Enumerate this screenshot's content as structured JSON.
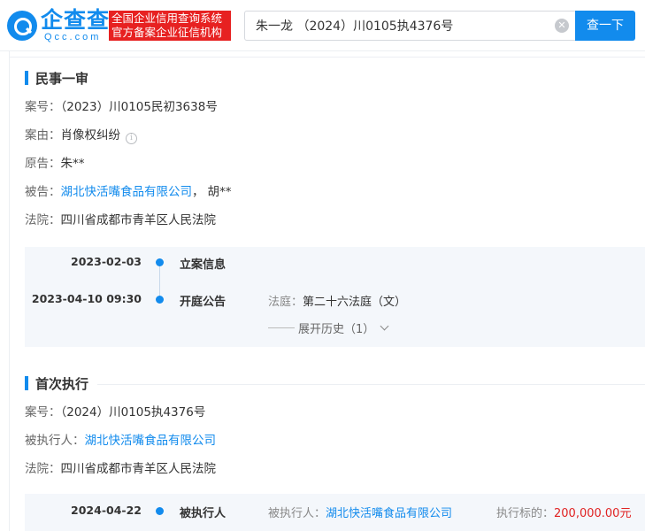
{
  "header": {
    "logo_cn": "企查查",
    "logo_en": "Qcc.com",
    "slogan_line1": "全国企业信用查询系统",
    "slogan_line2": "官方备案企业征信机构",
    "search_value": "朱一龙 （2024）川0105执4376号",
    "search_button": "查一下"
  },
  "first_trial": {
    "title": "民事一审",
    "case_no_label": "案号：",
    "case_no": "（2023）川0105民初3638号",
    "cause_label": "案由：",
    "cause": "肖像权纠纷",
    "plaintiff_label": "原告：",
    "plaintiff": "朱**",
    "defendant_label": "被告：",
    "defendant_company": "湖北快活嘴食品有限公司",
    "defendant_sep": "，",
    "defendant_person": "胡**",
    "court_label": "法院：",
    "court": "四川省成都市青羊区人民法院",
    "timeline": [
      {
        "date": "2023-02-03",
        "event": "立案信息"
      },
      {
        "date": "2023-04-10 09:30",
        "event": "开庭公告",
        "detail_label": "法庭：",
        "detail_value": "第二十六法庭（文）"
      }
    ],
    "expand_label": "展开历史（1）"
  },
  "execution": {
    "title": "首次执行",
    "case_no_label": "案号：",
    "case_no": "（2024）川0105执4376号",
    "executed_label": "被执行人：",
    "executed_company": "湖北快活嘴食品有限公司",
    "court_label": "法院：",
    "court": "四川省成都市青羊区人民法院",
    "timeline": [
      {
        "date": "2024-04-22",
        "event": "被执行人",
        "detail_label": "被执行人：",
        "detail_value": "湖北快活嘴食品有限公司",
        "amount_label": "执行标的：",
        "amount": "200,000.00元"
      }
    ]
  },
  "colors": {
    "brand": "#128bed",
    "slogan_bg": "#e72121",
    "amount": "#e02222"
  },
  "icons": [
    "search-logo-icon",
    "clear-icon",
    "info-icon",
    "chevron-down-icon"
  ]
}
